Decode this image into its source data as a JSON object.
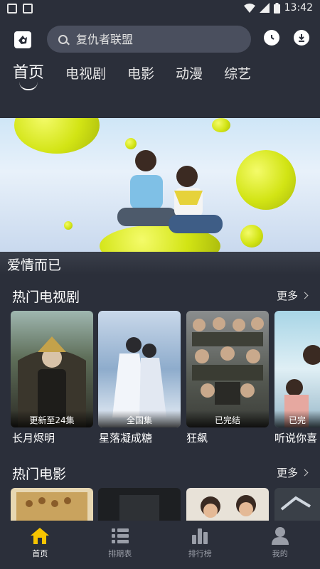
{
  "status_bar": {
    "time": "13:42"
  },
  "search": {
    "placeholder": "复仇者联盟"
  },
  "tabs": [
    {
      "label": "首页",
      "active": true
    },
    {
      "label": "电视剧"
    },
    {
      "label": "电影"
    },
    {
      "label": "动漫"
    },
    {
      "label": "综艺"
    }
  ],
  "banner": {
    "title": "爱情而已"
  },
  "sections": {
    "tv": {
      "title": "热门电视剧",
      "more": "更多",
      "items": [
        {
          "title": "长月烬明",
          "badge": "更新至24集"
        },
        {
          "title": "星落凝成糖",
          "badge": "全国集"
        },
        {
          "title": "狂飙",
          "badge": "已完结"
        },
        {
          "title": "听说你喜",
          "badge": "已完"
        }
      ]
    },
    "movies": {
      "title": "热门电影",
      "more": "更多"
    }
  },
  "bottom_nav": [
    {
      "label": "首页",
      "icon": "home-icon",
      "active": true
    },
    {
      "label": "排期表",
      "icon": "list-icon"
    },
    {
      "label": "排行榜",
      "icon": "bar-chart-icon"
    },
    {
      "label": "我的",
      "icon": "user-icon"
    }
  ],
  "colors": {
    "background": "#2b2f3a",
    "accent": "#f7c400",
    "search_bg": "#4a4f5e"
  }
}
